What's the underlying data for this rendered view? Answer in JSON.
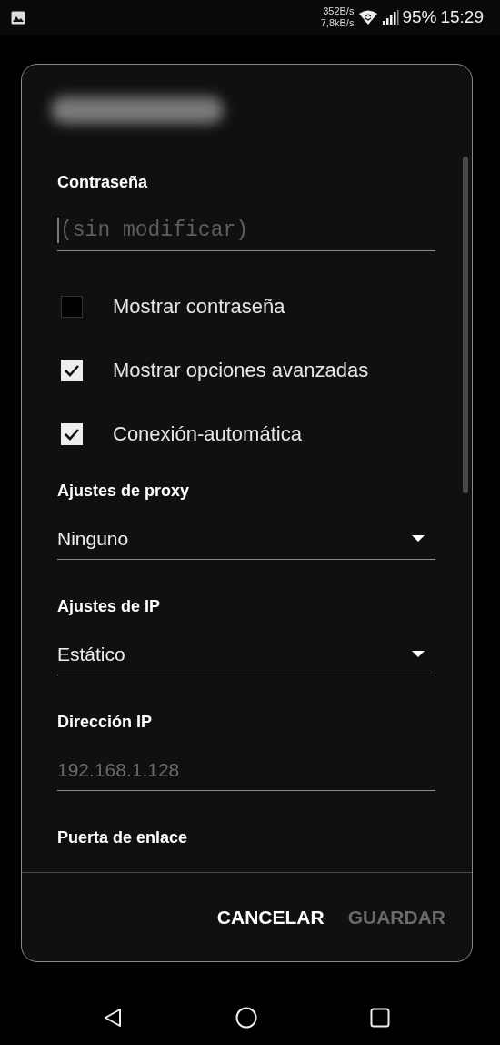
{
  "status_bar": {
    "upload_rate": "352B/s",
    "download_rate": "7,8kB/s",
    "battery": "95%",
    "time": "15:29"
  },
  "dialog": {
    "items": [
      {
        "kind": "password",
        "label": "Contraseña",
        "placeholder": "(sin modificar)"
      },
      {
        "kind": "checkbox",
        "label": "Mostrar contraseña",
        "checked": false
      },
      {
        "kind": "checkbox",
        "label": "Mostrar opciones avanzadas",
        "checked": true
      },
      {
        "kind": "checkbox",
        "label": "Conexión-automática",
        "checked": true
      },
      {
        "kind": "dropdown",
        "label": "Ajustes de proxy",
        "value": "Ninguno"
      },
      {
        "kind": "dropdown",
        "label": "Ajustes de IP",
        "value": "Estático"
      },
      {
        "kind": "text",
        "label": "Dirección IP",
        "placeholder": "192.168.1.128"
      },
      {
        "kind": "text",
        "label": "Puerta de enlace"
      }
    ],
    "buttons": [
      {
        "label": "CANCELAR",
        "disabled": false
      },
      {
        "label": "GUARDAR",
        "disabled": true
      }
    ]
  }
}
